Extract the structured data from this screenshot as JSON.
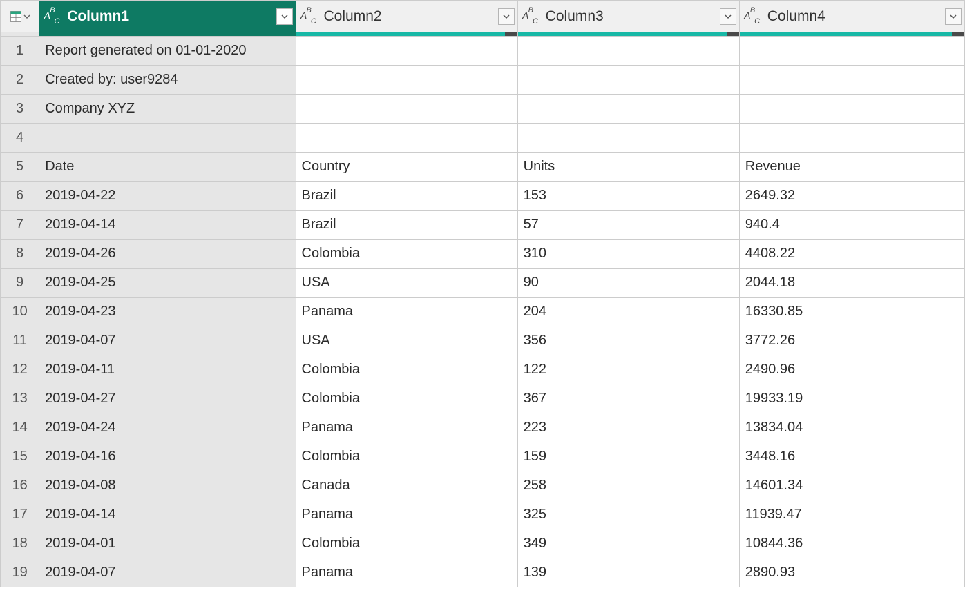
{
  "header": {
    "columns": [
      {
        "label": "Column1",
        "type_icon": "ABC",
        "selected": true
      },
      {
        "label": "Column2",
        "type_icon": "ABC",
        "selected": false
      },
      {
        "label": "Column3",
        "type_icon": "ABC",
        "selected": false
      },
      {
        "label": "Column4",
        "type_icon": "ABC",
        "selected": false
      }
    ]
  },
  "rows": [
    {
      "n": "1",
      "c": [
        "Report generated on 01-01-2020",
        "",
        "",
        ""
      ]
    },
    {
      "n": "2",
      "c": [
        "Created by: user9284",
        "",
        "",
        ""
      ]
    },
    {
      "n": "3",
      "c": [
        "Company XYZ",
        "",
        "",
        ""
      ]
    },
    {
      "n": "4",
      "c": [
        "",
        "",
        "",
        ""
      ]
    },
    {
      "n": "5",
      "c": [
        "Date",
        "Country",
        "Units",
        "Revenue"
      ]
    },
    {
      "n": "6",
      "c": [
        "2019-04-22",
        "Brazil",
        "153",
        "2649.32"
      ]
    },
    {
      "n": "7",
      "c": [
        "2019-04-14",
        "Brazil",
        "57",
        "940.4"
      ]
    },
    {
      "n": "8",
      "c": [
        "2019-04-26",
        "Colombia",
        "310",
        "4408.22"
      ]
    },
    {
      "n": "9",
      "c": [
        "2019-04-25",
        "USA",
        "90",
        "2044.18"
      ]
    },
    {
      "n": "10",
      "c": [
        "2019-04-23",
        "Panama",
        "204",
        "16330.85"
      ]
    },
    {
      "n": "11",
      "c": [
        "2019-04-07",
        "USA",
        "356",
        "3772.26"
      ]
    },
    {
      "n": "12",
      "c": [
        "2019-04-11",
        "Colombia",
        "122",
        "2490.96"
      ]
    },
    {
      "n": "13",
      "c": [
        "2019-04-27",
        "Colombia",
        "367",
        "19933.19"
      ]
    },
    {
      "n": "14",
      "c": [
        "2019-04-24",
        "Panama",
        "223",
        "13834.04"
      ]
    },
    {
      "n": "15",
      "c": [
        "2019-04-16",
        "Colombia",
        "159",
        "3448.16"
      ]
    },
    {
      "n": "16",
      "c": [
        "2019-04-08",
        "Canada",
        "258",
        "14601.34"
      ]
    },
    {
      "n": "17",
      "c": [
        "2019-04-14",
        "Panama",
        "325",
        "11939.47"
      ]
    },
    {
      "n": "18",
      "c": [
        "2019-04-01",
        "Colombia",
        "349",
        "10844.36"
      ]
    },
    {
      "n": "19",
      "c": [
        "2019-04-07",
        "Panama",
        "139",
        "2890.93"
      ]
    }
  ]
}
